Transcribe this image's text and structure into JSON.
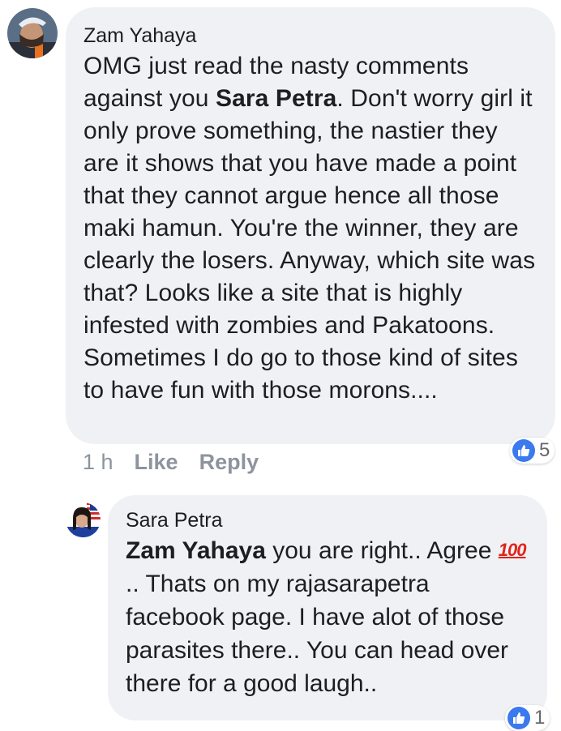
{
  "comment": {
    "author": "Zam Yahaya",
    "text_before": "OMG just read the nasty comments against you ",
    "mention": "Sara Petra",
    "text_after": ". Don't worry girl it only prove something, the nastier they are it shows that you have made a point that they cannot argue hence all those maki hamun. You're the winner, they are clearly the losers. Anyway, which site was that? Looks like a site that is highly infested with zombies and Pakatoons. Sometimes I do go to those kind of sites to have fun with those morons....",
    "time": "1 h",
    "like_label": "Like",
    "reply_label": "Reply",
    "reaction_count": "5"
  },
  "reply": {
    "author": "Sara Petra",
    "mention": "Zam Yahaya",
    "text_before": " you are right.. Agree ",
    "emoji": "100",
    "text_after": " .. Thats on my rajasarapetra facebook page. I have alot of those parasites there.. You can head over there for a good laugh..",
    "reaction_count": "1"
  },
  "colors": {
    "bubble": "#f0f1f4",
    "meta_text": "#8d949e",
    "like_blue": "#3b79ee",
    "emoji_red": "#e0241a"
  },
  "icons": {
    "reaction": "like-thumb-icon"
  }
}
